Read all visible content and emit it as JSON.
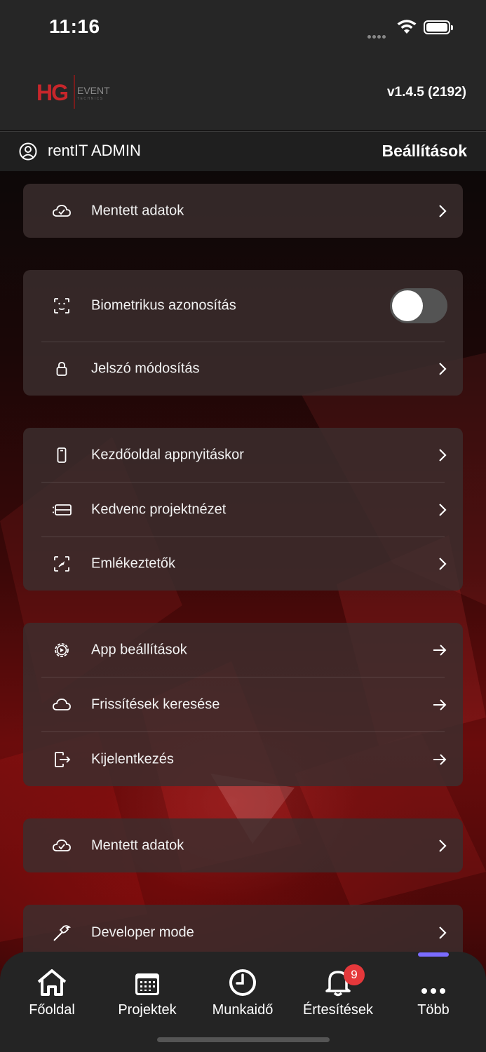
{
  "status_bar": {
    "time": "11:16"
  },
  "header": {
    "logo_letters": "HG",
    "logo_word": "EVENT",
    "logo_sub": "TECHNICS",
    "version": "v1.4.5 (2192)"
  },
  "user_bar": {
    "username": "rentIT ADMIN",
    "title": "Beállítások"
  },
  "cards": {
    "saved_top": {
      "label": "Mentett adatok",
      "icon": "cloud-check-icon"
    },
    "biometric": {
      "label": "Biometrikus azonosítás",
      "icon": "face-id-icon",
      "toggle_on": false
    },
    "password": {
      "label": "Jelszó módosítás",
      "icon": "lock-icon"
    },
    "start_page": {
      "label": "Kezdőoldal appnyitáskor",
      "icon": "phone-icon"
    },
    "project_view": {
      "label": "Kedvenc projektnézet",
      "icon": "list-view-icon"
    },
    "reminders": {
      "label": "Emlékeztetők",
      "icon": "reminder-icon"
    },
    "app_settings": {
      "label": "App beállítások",
      "icon": "gear-icon"
    },
    "updates": {
      "label": "Frissítések keresése",
      "icon": "cloud-icon"
    },
    "logout": {
      "label": "Kijelentkezés",
      "icon": "logout-icon"
    },
    "saved_bottom": {
      "label": "Mentett adatok",
      "icon": "cloud-check-icon"
    },
    "developer": {
      "label": "Developer mode",
      "icon": "hammer-icon"
    }
  },
  "tab_bar": {
    "tabs": [
      {
        "label": "Főoldal",
        "icon": "home-icon"
      },
      {
        "label": "Projektek",
        "icon": "calendar-icon"
      },
      {
        "label": "Munkaidő",
        "icon": "clock-icon"
      },
      {
        "label": "Értesítések",
        "icon": "bell-icon"
      },
      {
        "label": "Több",
        "icon": "more-icon"
      }
    ],
    "badge": "9",
    "active": "Több"
  },
  "colors": {
    "accent": "#7b6cff",
    "badge": "#e5383b",
    "brand": "#c8262b"
  }
}
